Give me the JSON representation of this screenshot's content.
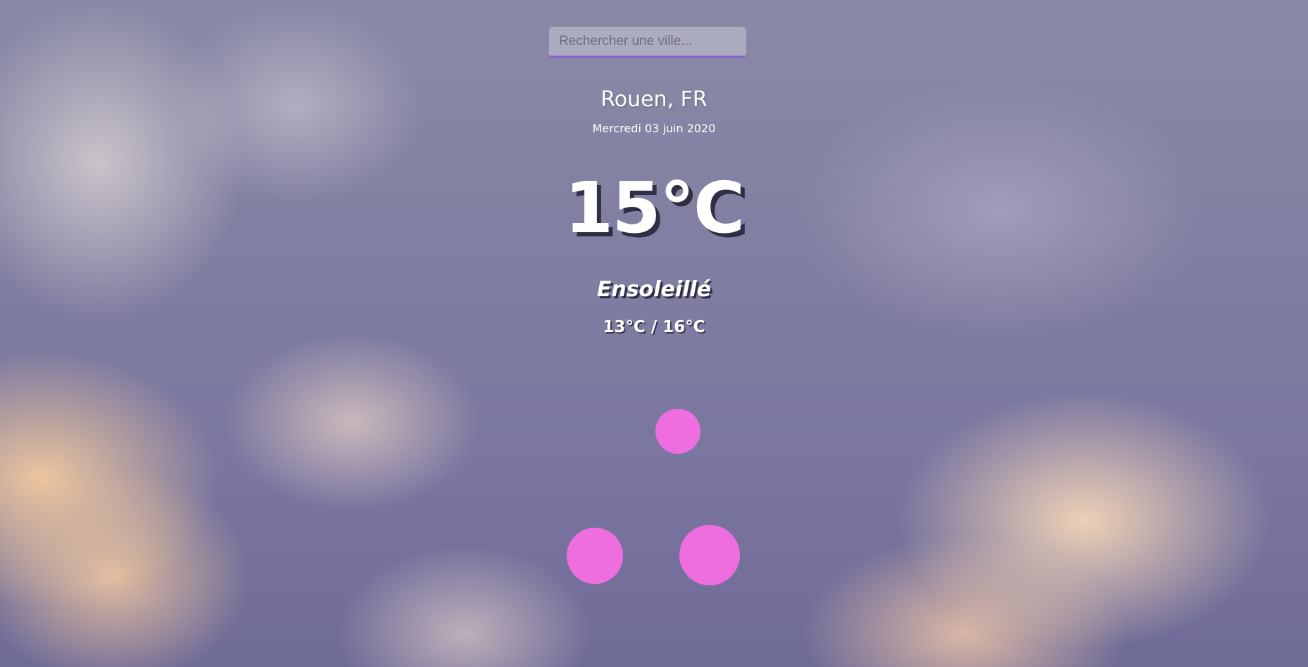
{
  "search": {
    "placeholder": "Rechercher une ville...",
    "value": ""
  },
  "weather": {
    "city": "Rouen, FR",
    "date": "Mercredi 03 juin 2020",
    "temperature": "15°C",
    "condition": "Ensoleillé",
    "range": "13°C / 16°C"
  },
  "colors": {
    "accent": "#8a5fc9",
    "loader_dots": "#ee6ee0",
    "text": "#ffffff",
    "text_shadow": "#2e2f45"
  }
}
